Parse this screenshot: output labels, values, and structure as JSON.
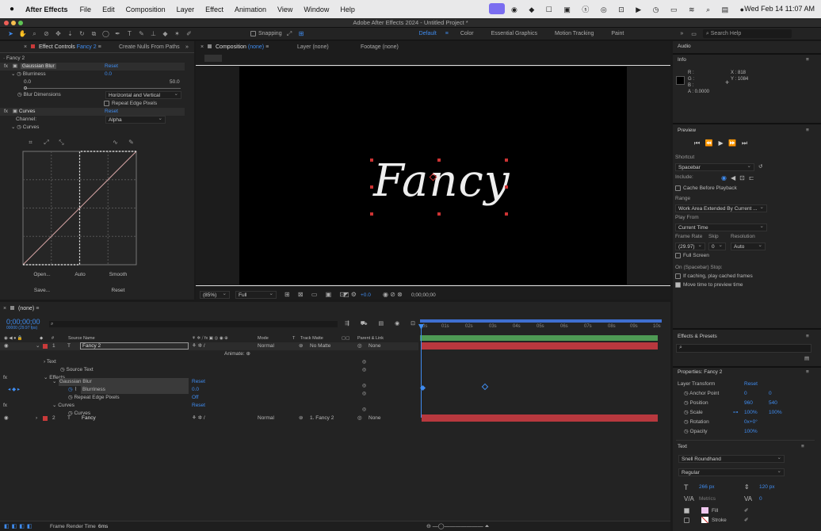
{
  "menubar": {
    "app": "After Effects",
    "items": [
      "File",
      "Edit",
      "Composition",
      "Layer",
      "Effect",
      "Animation",
      "View",
      "Window",
      "Help"
    ],
    "clock": "Wed Feb 14  11:07 AM"
  },
  "window": {
    "title": "Adobe After Effects 2024 - Untitled Project *"
  },
  "toolbar": {
    "snapping": "Snapping",
    "workspaces": [
      "Default",
      "Color",
      "Essential Graphics",
      "Motion Tracking",
      "Paint"
    ],
    "active_workspace": "Default",
    "search_placeholder": "Search Help"
  },
  "effect_controls": {
    "tab_label": "Effect Controls",
    "tab_layer": "Fancy 2",
    "tab2": "Create Nulls From Paths",
    "layer_path": "· Fancy 2",
    "blur": {
      "name": "Gaussian Blur",
      "reset": "Reset",
      "blurriness_label": "Blurriness",
      "blurriness_value": "0.0",
      "slider_min": "0.0",
      "slider_max": "50.0",
      "blur_dims_label": "Blur Dimensions",
      "blur_dims_value": "Horizontal and Vertical",
      "repeat_edge": "Repeat Edge Pixels"
    },
    "curves": {
      "name": "Curves",
      "reset": "Reset",
      "channel_label": "Channel:",
      "channel_value": "Alpha",
      "curves_label": "Curves",
      "open": "Open...",
      "auto": "Auto",
      "smooth": "Smooth",
      "save": "Save...",
      "reset_btn": "Reset"
    }
  },
  "composition": {
    "tab_label": "Composition",
    "tab_name": "(none)",
    "layer_tab": "Layer (none)",
    "footage_tab": "Footage (none)",
    "text": "Fancy",
    "zoom": "(85%)",
    "quality": "Full",
    "exposure": "+0.0",
    "timecode": "0;00;00;00"
  },
  "right_panel": {
    "audio": "Audio",
    "info": "Info",
    "info_r": "R :",
    "info_g": "G :",
    "info_b": "B :",
    "info_a": "A : 0.0000",
    "info_x": "X : 818",
    "info_y": "Y : 1084",
    "preview": "Preview",
    "shortcut_label": "Shortcut",
    "shortcut_value": "Spacebar",
    "include_label": "Include:",
    "cache_label": "Cache Before Playback",
    "range_label": "Range",
    "range_value": "Work Area Extended By Current ...",
    "play_from_label": "Play From",
    "play_from_value": "Current Time",
    "frame_rate_label": "Frame Rate",
    "frame_rate_value": "(29.97)",
    "skip_label": "Skip",
    "skip_value": "0",
    "resolution_label": "Resolution",
    "resolution_value": "Auto",
    "full_screen": "Full Screen",
    "on_stop_label": "On (Spacebar) Stop:",
    "if_caching": "If caching, play cached frames",
    "move_time": "Move time to preview time",
    "effects_presets": "Effects & Presets",
    "properties_title": "Properties: Fancy 2",
    "layer_transform": "Layer Transform",
    "reset": "Reset",
    "anchor_label": "Anchor Point",
    "anchor_x": "0",
    "anchor_y": "0",
    "position_label": "Position",
    "position_x": "960",
    "position_y": "540",
    "scale_label": "Scale",
    "scale_x": "100%",
    "scale_y": "100%",
    "rotation_label": "Rotation",
    "rotation_value": "0x+0°",
    "opacity_label": "Opacity",
    "opacity_value": "100%",
    "text_label": "Text",
    "font": "Snell Roundhand",
    "style": "Regular",
    "font_size": "266 px",
    "leading": "120 px",
    "kerning": "Metrics",
    "tracking": "0",
    "fill": "Fill",
    "stroke": "Stroke"
  },
  "timeline": {
    "comp_name": "(none)",
    "timecode": "0;00;00;00",
    "fps": "00000 (29.97 fps)",
    "columns": {
      "source_name": "Source Name",
      "mode": "Mode",
      "t": "T",
      "track_matte": "Track Matte",
      "parent": "Parent & Link"
    },
    "ruler": [
      "0s",
      "01s",
      "02s",
      "03s",
      "04s",
      "05s",
      "06s",
      "07s",
      "08s",
      "09s",
      "10s"
    ],
    "layer1": {
      "num": "1",
      "name": "Fancy 2",
      "mode": "Normal",
      "matte": "No Matte",
      "parent": "None"
    },
    "animate": "Animate:",
    "text": "Text",
    "source_text": "Source Text",
    "effects": "Effects",
    "gaussian_blur": "Gaussian Blur",
    "reset": "Reset",
    "blurriness": "Blurriness",
    "blurriness_value": "0.0",
    "repeat_edge": "Repeat Edge Pixels",
    "repeat_value": "Off",
    "curves": "Curves",
    "curves_sub": "Curves",
    "layer2": {
      "num": "2",
      "name": "Fancy",
      "mode": "Normal",
      "matte": "1. Fancy 2",
      "parent": "None"
    },
    "render_time_label": "Frame Render Time",
    "render_time_value": "6ms"
  },
  "colors": {
    "accent": "#3f8cf0",
    "layer_bar": "#b8383e",
    "work_area": "#4e9a54",
    "label_red": "#c93a3a"
  }
}
